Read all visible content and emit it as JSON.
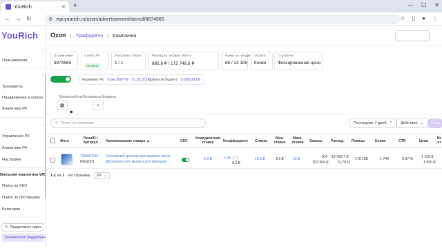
{
  "browser": {
    "tab_title": "YouRich",
    "tab_close": "✕",
    "new_tab": "+",
    "url": "mp.yourich.ru/ozon/advertisement/stencil/8874665",
    "win_controls": [
      "—",
      "☐",
      "✕"
    ]
  },
  "sidebar": {
    "logo": "YouRich",
    "items": [
      {
        "label": "Пользователи",
        "type": "item"
      },
      {
        "label": "Трафареты",
        "type": "item"
      },
      {
        "label": "Продвижение в поиске",
        "type": "item"
      },
      {
        "label": "Аналитика РК",
        "type": "item"
      },
      {
        "label": "Управление РК",
        "type": "item"
      },
      {
        "label": "Аналитика РК",
        "type": "item"
      },
      {
        "label": "Настройки",
        "type": "item"
      },
      {
        "label": "Внешняя аналитика WB",
        "type": "section"
      },
      {
        "label": "Поиск по SKU",
        "type": "item"
      },
      {
        "label": "Поиск по поставщику",
        "type": "item"
      },
      {
        "label": "Категории",
        "type": "item"
      }
    ],
    "idea_button": "Предложить идею",
    "support_button": "Техническая поддержка"
  },
  "header": {
    "platform": "Ozon",
    "section": "Трафареты",
    "separator": "|",
    "page": "Кампания"
  },
  "cards": [
    {
      "label": "ID кампании",
      "value": "8874665"
    },
    {
      "label": "Статус РК",
      "badge": "Активна"
    },
    {
      "label": "Участвуют / Всего",
      "value": "1 / 1"
    },
    {
      "label": "Расход за сегодня / Всего",
      "value": "885,8 ₽ / 172 748,6 ₽"
    },
    {
      "label": "Клики за сегодня / Всего",
      "value": "86 / 13 159"
    },
    {
      "label": "Оплата",
      "value": "Клики"
    },
    {
      "label": "Стратегия",
      "value": "Фиксированная цена"
    }
  ],
  "campaign": {
    "name_label": "Название РК:",
    "name_value": "Клик 30ОТW · 01.03.2024",
    "budget_label": "Дневной бюджет:",
    "budget_value": "3 000 000 ₽",
    "work_time_label": "Время работы",
    "intervals_label": "Интервалы бюджета",
    "calendar_icon": "▦",
    "add_icon": "+"
  },
  "toolbar": {
    "search_placeholder": "Поиск по названию",
    "period": "Последние 7 дней",
    "actions": "Действия",
    "save": "Сохр"
  },
  "table": {
    "headers": {
      "photo": "Фото",
      "sku": "OzonID / Артикул",
      "name": "Наименование товара ▲",
      "cks": "СКС",
      "competitive_bid": "Конкурентная ставка",
      "coefficient": "Коэффициент",
      "bid": "Ставка",
      "min_bid": "Мин. ставка",
      "max_bid": "Макс. ставка",
      "orders": "Заказы",
      "spend": "Расход",
      "views": "Показы",
      "clicks": "Клики",
      "ctr": "CTR",
      "price": "Цена",
      "last": "Ис ст"
    },
    "rows": [
      {
        "ozon_id": "730947339",
        "article": "NGSD01",
        "name_line1": "Сенсорный дозатор для жидкого мыла",
        "name_line2": "Диспенсер для мыла и для моющего...",
        "competitive_bid": "5,9 ₽",
        "coefficient": "1,05",
        "coefficient_sub": "6,2 ₽",
        "bid": "10,3 ₽",
        "min_bid": "3,5 ₽",
        "max_bid": "15 ₽",
        "orders": "104",
        "orders_sub": "152 364 ₽",
        "spend": "19 493,7 ₽",
        "spend_sub": "12,79 %",
        "views": "179 188",
        "clicks": "1 744",
        "ctr": "0,97 %",
        "price": "1 158 ₽",
        "price_sub": "1 650 ₽"
      }
    ]
  },
  "pager": {
    "range": "1-1",
    "of": "из",
    "total": "1",
    "per_page_label": "На странице",
    "per_page": "20"
  }
}
